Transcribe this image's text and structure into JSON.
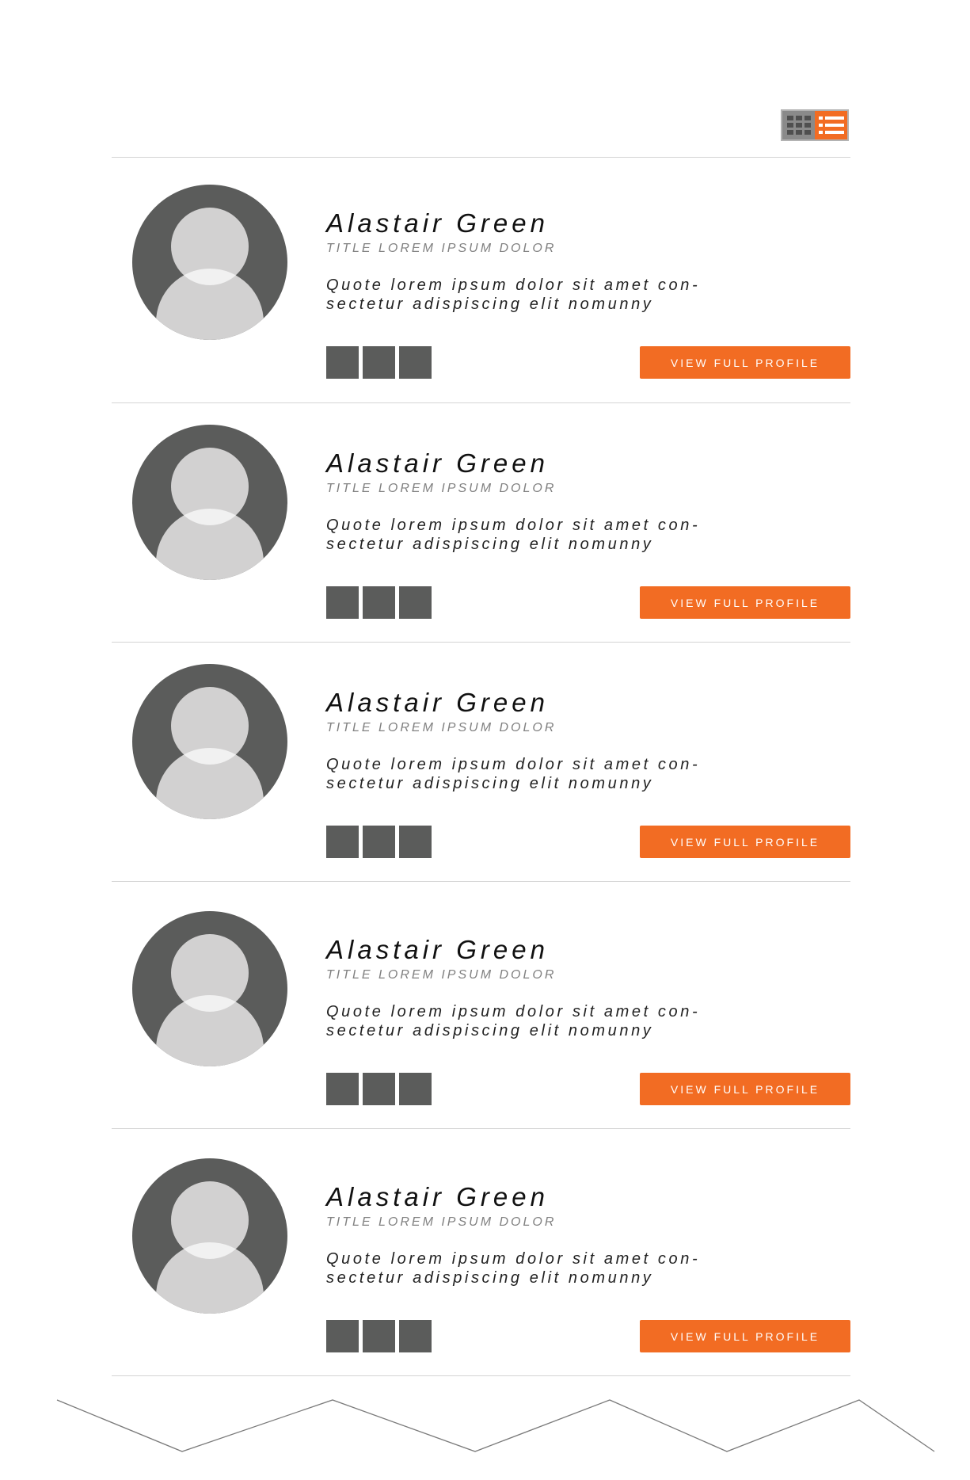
{
  "view_toggle": {
    "grid_icon": "grid-icon",
    "list_icon": "list-icon",
    "active": "list"
  },
  "colors": {
    "accent": "#f26c23",
    "avatar_dark": "#5b5c5b",
    "avatar_light": "#d2d1d1",
    "divider": "#d4d4d4"
  },
  "profiles": [
    {
      "name": "Alastair Green",
      "title": "TITLE LOREM IPSUM DOLOR",
      "quote_line1": "Quote lorem ipsum dolor sit amet con-",
      "quote_line2": "sectetur adispiscing elit nomunny",
      "button_label": "VIEW FULL PROFILE"
    },
    {
      "name": "Alastair Green",
      "title": "TITLE LOREM IPSUM DOLOR",
      "quote_line1": "Quote lorem ipsum dolor sit amet con-",
      "quote_line2": "sectetur adispiscing elit nomunny",
      "button_label": "VIEW FULL PROFILE"
    },
    {
      "name": "Alastair Green",
      "title": "TITLE LOREM IPSUM DOLOR",
      "quote_line1": "Quote lorem ipsum dolor sit amet con-",
      "quote_line2": "sectetur adispiscing elit nomunny",
      "button_label": "VIEW FULL PROFILE"
    },
    {
      "name": "Alastair Green",
      "title": "TITLE LOREM IPSUM DOLOR",
      "quote_line1": "Quote lorem ipsum dolor sit amet con-",
      "quote_line2": "sectetur adispiscing elit nomunny",
      "button_label": "VIEW FULL PROFILE"
    },
    {
      "name": "Alastair Green",
      "title": "TITLE LOREM IPSUM DOLOR",
      "quote_line1": "Quote lorem ipsum dolor sit amet con-",
      "quote_line2": "sectetur adispiscing elit nomunny",
      "button_label": "VIEW FULL PROFILE"
    }
  ]
}
